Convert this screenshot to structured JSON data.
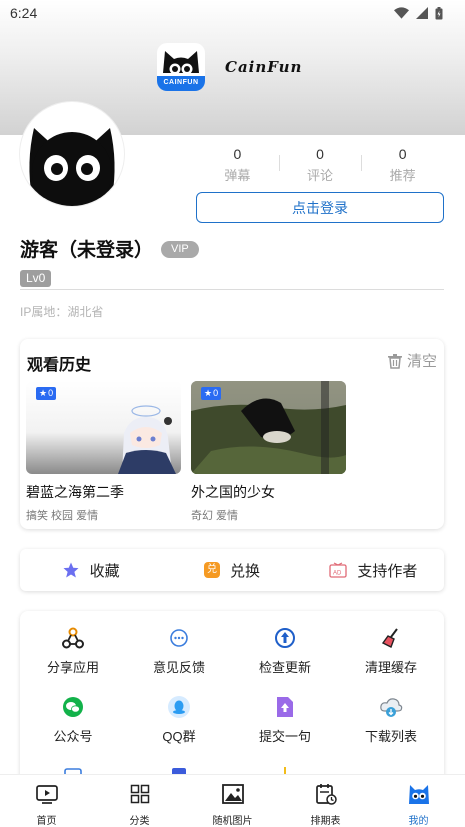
{
  "status_bar": {
    "time": "6:24"
  },
  "app": {
    "name": "CainFun",
    "logo_text": "CAINFUN"
  },
  "profile": {
    "stats": [
      {
        "value": "0",
        "label": "弹幕"
      },
      {
        "value": "0",
        "label": "评论"
      },
      {
        "value": "0",
        "label": "推荐"
      }
    ],
    "login_label": "点击登录",
    "username": "游客（未登录）",
    "vip_label": "VIP",
    "level": "Lv0",
    "ip_location": "IP属地：湖北省"
  },
  "history": {
    "title": "观看历史",
    "clear_label": "清空",
    "items": [
      {
        "badge": "0",
        "title": "碧蓝之海第二季",
        "tags": "搞笑 校园 爱情"
      },
      {
        "badge": "0",
        "title": "外之国的少女",
        "tags": "奇幻 爱情"
      }
    ]
  },
  "actions": [
    {
      "label": "收藏",
      "icon": "star-icon"
    },
    {
      "label": "兑换",
      "icon": "exchange-icon"
    },
    {
      "label": "支持作者",
      "icon": "ad-icon"
    }
  ],
  "grid": [
    {
      "label": "分享应用",
      "icon": "share-icon"
    },
    {
      "label": "意见反馈",
      "icon": "feedback-icon"
    },
    {
      "label": "检查更新",
      "icon": "update-icon"
    },
    {
      "label": "清理缓存",
      "icon": "broom-icon"
    },
    {
      "label": "公众号",
      "icon": "wechat-icon"
    },
    {
      "label": "QQ群",
      "icon": "qq-icon"
    },
    {
      "label": "提交一句",
      "icon": "upload-file-icon"
    },
    {
      "label": "下载列表",
      "icon": "cloud-download-icon"
    }
  ],
  "tabs": [
    {
      "label": "首页",
      "icon": "tv-icon"
    },
    {
      "label": "分类",
      "icon": "grid-icon"
    },
    {
      "label": "随机图片",
      "icon": "image-icon"
    },
    {
      "label": "排期表",
      "icon": "schedule-icon"
    },
    {
      "label": "我的",
      "icon": "cat-icon",
      "active": true
    }
  ],
  "colors": {
    "accent": "#1f71c9",
    "badge_blue": "#2a6bf2",
    "cat_blue": "#1a73e8"
  }
}
